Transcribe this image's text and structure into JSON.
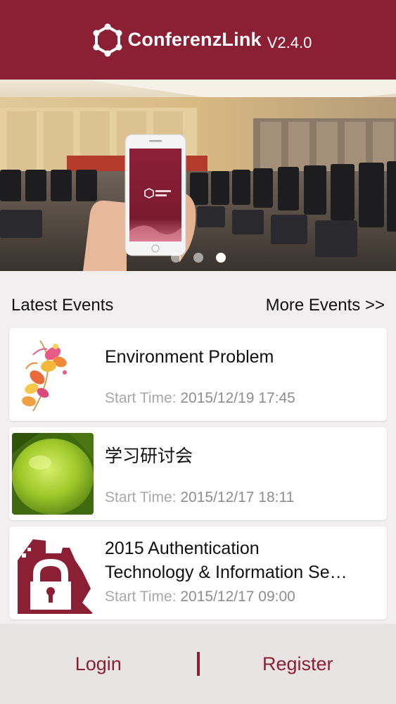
{
  "header": {
    "brand_name": "ConferenzLink",
    "version": "V2.4.0",
    "logo_icon": "network-hexagon-logo",
    "background": "#8b1f34"
  },
  "banner": {
    "slides_count": 3,
    "active_slide": 3,
    "phone_text": "ConferenzLink 会议助手"
  },
  "section": {
    "title": "Latest Events",
    "more_label": "More Events >>"
  },
  "events": [
    {
      "title": "Environment Problem",
      "time_label": "Start Time:",
      "time_value": "2015/12/19 17:45",
      "thumbnail": "flower-illustration"
    },
    {
      "title": "学习研讨会",
      "time_label": "Start Time:",
      "time_value": "2015/12/17 18:11",
      "thumbnail": "green-fruit-photo"
    },
    {
      "title_line1": "2015 Authentication",
      "title_line2": "Technology & Information Se…",
      "time_label": "Start Time:",
      "time_value": "2015/12/17 09:00",
      "thumbnail": "padlock-castle-icon"
    }
  ],
  "bottom_bar": {
    "login_label": "Login",
    "register_label": "Register",
    "accent": "#8b1f34"
  }
}
